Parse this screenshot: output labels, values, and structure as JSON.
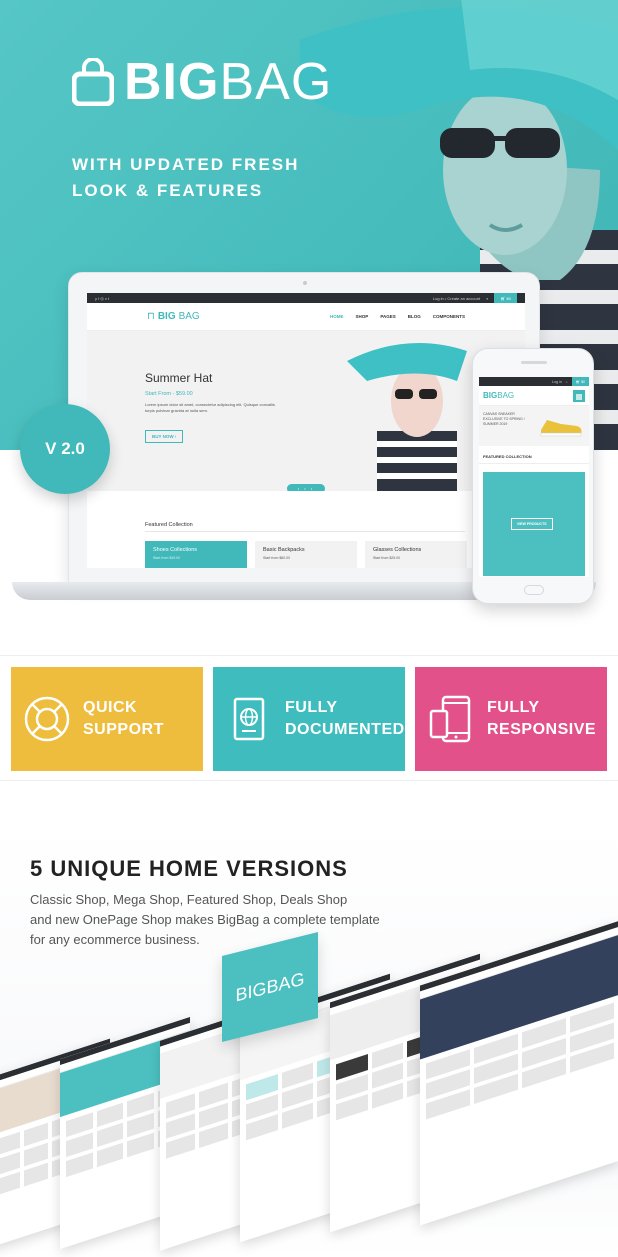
{
  "brand": {
    "name_bold": "BIG",
    "name_light": "BAG",
    "accent": "#41b8b9"
  },
  "hero": {
    "tagline_line1": "WITH UPDATED FRESH",
    "tagline_line2": "LOOK & FEATURES",
    "version": "V 2.0"
  },
  "laptop_site": {
    "topbar_social": "y f ◎ v t",
    "topbar_links": "Log in • Create an account",
    "cart": "$0",
    "logo_bold": "BIG",
    "logo_light": "BAG",
    "menu": [
      "HOME",
      "SHOP",
      "PAGES",
      "BLOG",
      "COMPONENTS"
    ],
    "slide_title": "Summer Hat",
    "slide_price": "Start From - $59.00",
    "slide_text": "Lorem ipsum dolor sit amet, consectetur adipiscing elit. Quisque convallis turpis pulvinar gravida at nulla sem.",
    "buy_button": "BUY NOW ›",
    "slider_dots": "• • •",
    "featured_title": "Featured Collection",
    "cards": [
      {
        "title": "Shoes Collections",
        "sub": "Start from $49.00"
      },
      {
        "title": "Basic Backpacks",
        "sub": "Start from $60.00"
      },
      {
        "title": "Glasses Collections",
        "sub": "Start from $25.00"
      }
    ]
  },
  "phone_site": {
    "topbar": "Log in",
    "cart": "$0",
    "logo_bold": "BIG",
    "logo_light": "BAG",
    "banner_title": "CANVAS SNEAKER",
    "banner_sub": "EXCLUSIVE TO SPRING / SUMMER 2019",
    "featured": "FEATURED COLLECTION",
    "view_products": "VIEW PRODUCTS"
  },
  "features": [
    {
      "line1": "QUICK",
      "line2": "SUPPORT",
      "color": "#eebd3e",
      "icon": "lifebuoy-icon"
    },
    {
      "line1": "FULLY",
      "line2": "DOCUMENTED",
      "color": "#3fbcbd",
      "icon": "passport-icon"
    },
    {
      "line1": "FULLY",
      "line2": "RESPONSIVE",
      "color": "#e2518a",
      "icon": "devices-icon"
    }
  ],
  "versions": {
    "title": "5 UNIQUE HOME VERSIONS",
    "desc_line1": "Classic Shop, Mega Shop, Featured Shop, Deals Shop",
    "desc_line2": "and new OnePage Shop makes BigBag a complete template",
    "desc_line3": "for any ecommerce business.",
    "logo_card": "BIGBAG"
  }
}
